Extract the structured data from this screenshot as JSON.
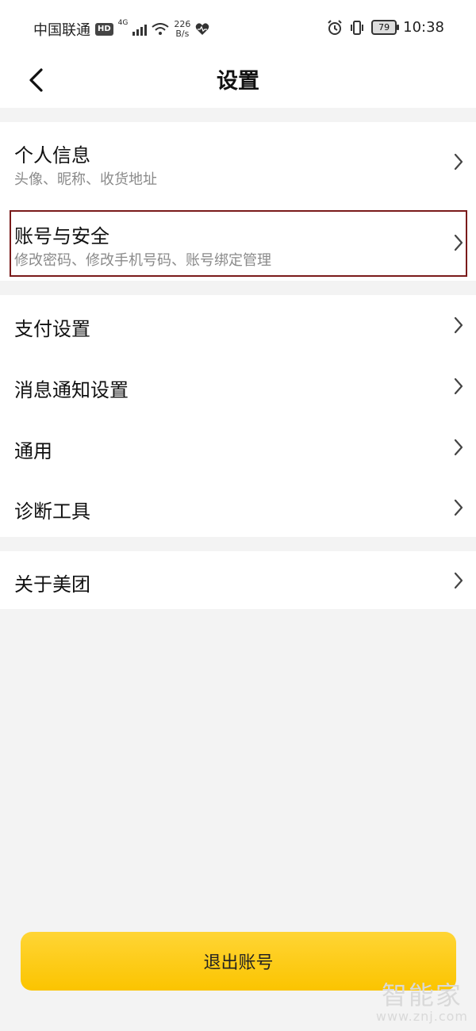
{
  "status_bar": {
    "carrier": "中国联通",
    "hd_badge": "HD",
    "network_type": "4G",
    "speed_value": "226",
    "speed_unit": "B/s",
    "battery_level": "79",
    "time": "10:38"
  },
  "header": {
    "title": "设置",
    "back_icon": "chevron-left-icon"
  },
  "sections": {
    "profile": {
      "title": "个人信息",
      "subtitle": "头像、昵称、收货地址"
    },
    "account": {
      "title": "账号与安全",
      "subtitle": "修改密码、修改手机号码、账号绑定管理"
    },
    "payment": {
      "title": "支付设置"
    },
    "notifications": {
      "title": "消息通知设置"
    },
    "general": {
      "title": "通用"
    },
    "diagnostics": {
      "title": "诊断工具"
    },
    "about": {
      "title": "关于美团"
    }
  },
  "logout_label": "退出账号",
  "watermark": {
    "logo_text": "智能家",
    "url": "www.znj.com"
  },
  "colors": {
    "accent_yellow": "#fbc400",
    "background": "#f3f3f3",
    "highlight_border": "#7a1a1a"
  }
}
